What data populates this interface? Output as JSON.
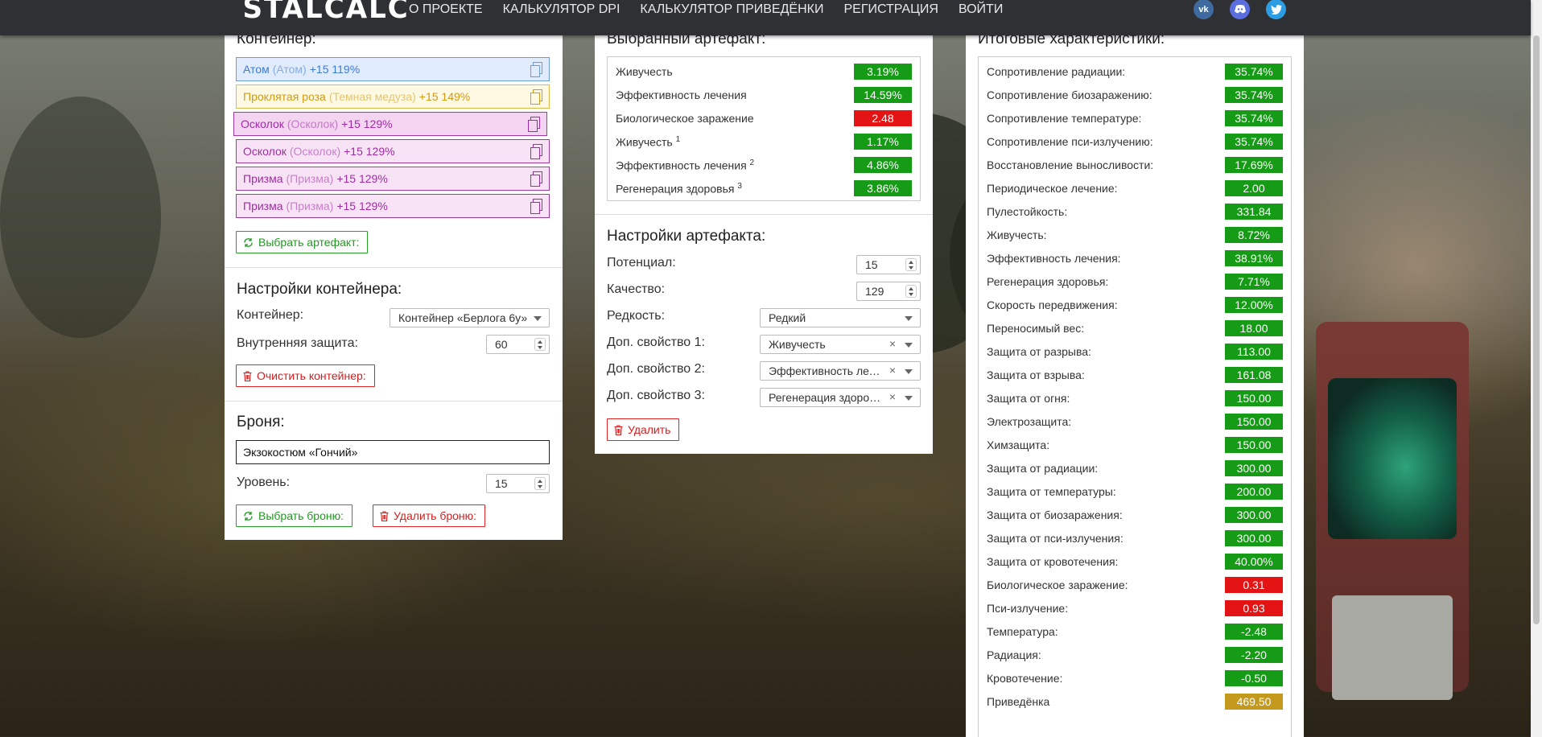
{
  "nav": {
    "logo": "STALCALC",
    "links": [
      "О ПРОЕКТЕ",
      "КАЛЬКУЛЯТОР DPI",
      "КАЛЬКУЛЯТОР ПРИВЕДЁНКИ",
      "РЕГИСТРАЦИЯ",
      "ВОЙТИ"
    ],
    "social": [
      "vk-icon",
      "discord-icon",
      "twitter-icon"
    ]
  },
  "container": {
    "title": "Контейнер:",
    "items": [
      {
        "name": "Атом",
        "alias": "(Атом)",
        "bonus": "+15 119%",
        "color": "blue"
      },
      {
        "name": "Проклятая роза",
        "alias": "(Темная медуза)",
        "bonus": "+15 149%",
        "color": "yellow"
      },
      {
        "name": "Осколок",
        "alias": "(Осколок)",
        "bonus": "+15 129%",
        "color": "pink"
      },
      {
        "name": "Осколок",
        "alias": "(Осколок)",
        "bonus": "+15 129%",
        "color": "pink"
      },
      {
        "name": "Призма",
        "alias": "(Призма)",
        "bonus": "+15 129%",
        "color": "pink"
      },
      {
        "name": "Призма",
        "alias": "(Призма)",
        "bonus": "+15 129%",
        "color": "pink"
      }
    ],
    "select_button": "Выбрать артефакт:"
  },
  "container_settings": {
    "title": "Настройки контейнера:",
    "container_label": "Контейнер:",
    "container_value": "Контейнер «Берлога 6у»",
    "protection_label": "Внутренняя защита:",
    "protection_value": "60",
    "clear_button": "Очистить контейнер:"
  },
  "armor": {
    "title": "Броня:",
    "name": "Экзокостюм «Гончий»",
    "level_label": "Уровень:",
    "level_value": "15",
    "select_button": "Выбрать броню:",
    "delete_button": "Удалить броню:"
  },
  "selected_artifact": {
    "title": "Выбранный артефакт:",
    "stats": [
      {
        "name": "Живучесть",
        "sup": "",
        "value": "3.19%",
        "color": "green"
      },
      {
        "name": "Эффективность лечения",
        "sup": "",
        "value": "14.59%",
        "color": "green"
      },
      {
        "name": "Биологическое заражение",
        "sup": "",
        "value": "2.48",
        "color": "red"
      },
      {
        "name": "Живучесть",
        "sup": "1",
        "value": "1.17%",
        "color": "green"
      },
      {
        "name": "Эффективность лечения",
        "sup": "2",
        "value": "4.86%",
        "color": "green"
      },
      {
        "name": "Регенерация здоровья",
        "sup": "3",
        "value": "3.86%",
        "color": "green"
      }
    ]
  },
  "artifact_settings": {
    "title": "Настройки артефакта:",
    "potential_label": "Потенциал:",
    "potential_value": "15",
    "quality_label": "Качество:",
    "quality_value": "129",
    "rarity_label": "Редкость:",
    "rarity_value": "Редкий",
    "prop1_label": "Доп. свойство 1:",
    "prop1_value": "Живучесть",
    "prop2_label": "Доп. свойство 2:",
    "prop2_value": "Эффективность лечения",
    "prop3_label": "Доп. свойство 3:",
    "prop3_value": "Регенерация здоровья",
    "delete_button": "Удалить"
  },
  "totals": {
    "title": "Итоговые характеристики:",
    "stats": [
      {
        "name": "Сопротивление радиации:",
        "value": "35.74%",
        "color": "green"
      },
      {
        "name": "Сопротивление биозаражению:",
        "value": "35.74%",
        "color": "green"
      },
      {
        "name": "Сопротивление температуре:",
        "value": "35.74%",
        "color": "green"
      },
      {
        "name": "Сопротивление пси-излучению:",
        "value": "35.74%",
        "color": "green"
      },
      {
        "name": "Восстановление выносливости:",
        "value": "17.69%",
        "color": "green"
      },
      {
        "name": "Периодическое лечение:",
        "value": "2.00",
        "color": "green"
      },
      {
        "name": "Пулестойкость:",
        "value": "331.84",
        "color": "green"
      },
      {
        "name": "Живучесть:",
        "value": "8.72%",
        "color": "green"
      },
      {
        "name": "Эффективность лечения:",
        "value": "38.91%",
        "color": "green"
      },
      {
        "name": "Регенерация здоровья:",
        "value": "7.71%",
        "color": "green"
      },
      {
        "name": "Скорость передвижения:",
        "value": "12.00%",
        "color": "green"
      },
      {
        "name": "Переносимый вес:",
        "value": "18.00",
        "color": "green"
      },
      {
        "name": "Защита от разрыва:",
        "value": "113.00",
        "color": "green"
      },
      {
        "name": "Защита от взрыва:",
        "value": "161.08",
        "color": "green"
      },
      {
        "name": "Защита от огня:",
        "value": "150.00",
        "color": "green"
      },
      {
        "name": "Электрозащита:",
        "value": "150.00",
        "color": "green"
      },
      {
        "name": "Химзащита:",
        "value": "150.00",
        "color": "green"
      },
      {
        "name": "Защита от радиации:",
        "value": "300.00",
        "color": "green"
      },
      {
        "name": "Защита от температуры:",
        "value": "200.00",
        "color": "green"
      },
      {
        "name": "Защита от биозаражения:",
        "value": "300.00",
        "color": "green"
      },
      {
        "name": "Защита от пси-излучения:",
        "value": "300.00",
        "color": "green"
      },
      {
        "name": "Защита от кровотечения:",
        "value": "40.00%",
        "color": "green"
      },
      {
        "name": "Биологическое заражение:",
        "value": "0.31",
        "color": "red"
      },
      {
        "name": "Пси-излучение:",
        "value": "0.93",
        "color": "red"
      },
      {
        "name": "Температура:",
        "value": "-2.48",
        "color": "green"
      },
      {
        "name": "Радиация:",
        "value": "-2.20",
        "color": "green"
      },
      {
        "name": "Кровотечение:",
        "value": "-0.50",
        "color": "green"
      },
      {
        "name": "Приведёнка",
        "value": "469.50",
        "color": "gold"
      }
    ]
  }
}
